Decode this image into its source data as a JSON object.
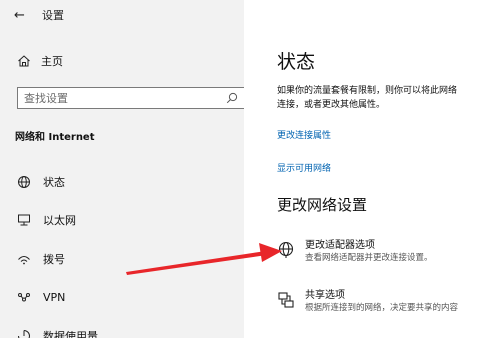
{
  "window": {
    "title": "设置",
    "back_icon": "back-arrow-icon"
  },
  "sidebar": {
    "home_label": "主页",
    "search_placeholder": "查找设置",
    "section_title": "网络和 Internet",
    "items": [
      {
        "label": "状态",
        "icon": "globe-icon"
      },
      {
        "label": "以太网",
        "icon": "ethernet-icon"
      },
      {
        "label": "拨号",
        "icon": "dialup-icon"
      },
      {
        "label": "VPN",
        "icon": "vpn-icon"
      },
      {
        "label": "数据使用量",
        "icon": "data-usage-icon"
      }
    ]
  },
  "main": {
    "title": "状态",
    "description_line1": "如果你的流量套餐有限制，则你可以将此网络",
    "description_line2": "连接，或者更改其他属性。",
    "link_properties": "更改连接属性",
    "link_networks": "显示可用网络",
    "subtitle": "更改网络设置",
    "options": [
      {
        "title": "更改适配器选项",
        "desc": "查看网络适配器并更改连接设置。",
        "icon": "adapter-icon"
      },
      {
        "title": "共享选项",
        "desc": "根据所连接到的网络，决定要共享的内容",
        "icon": "sharing-icon"
      }
    ]
  },
  "annotation": {
    "arrow_color": "#e8262a"
  },
  "colors": {
    "sidebar_bg": "#f2f2f2",
    "link": "#0063b1"
  }
}
